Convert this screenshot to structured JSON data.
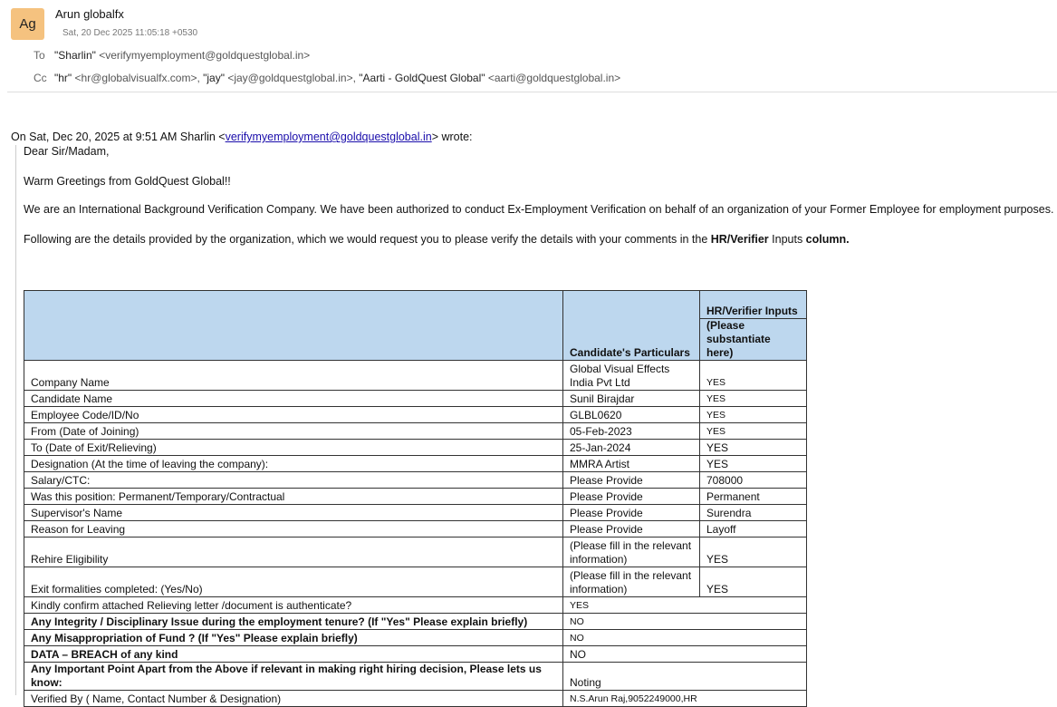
{
  "header": {
    "avatar": "Ag",
    "sender": "Arun globalfx",
    "date": "Sat, 20 Dec 2025 11:05:18 +0530",
    "to_label": "To",
    "to_name": "\"Sharlin\"",
    "to_addr": " <verifymyemployment@goldquestglobal.in>",
    "cc_label": "Cc",
    "cc": [
      {
        "name": "\"hr\"",
        "addr": " <hr@globalvisualfx.com>, "
      },
      {
        "name": "\"jay\"",
        "addr": " <jay@goldquestglobal.in>, "
      },
      {
        "name": "\"Aarti - GoldQuest Global\"",
        "addr": " <aarti@goldquestglobal.in>"
      }
    ]
  },
  "quote": {
    "intro_pre": "On Sat, Dec 20, 2025 at 9:51 AM Sharlin <",
    "intro_link": "verifymyemployment@goldquestglobal.in",
    "intro_post": "> wrote:",
    "p1": "Dear Sir/Madam,",
    "p2": "Warm Greetings from GoldQuest Global!!",
    "p3": "We are an International Background Verification Company. We have been authorized to conduct Ex-Employment Verification on behalf of an organization of your Former Employee for employment purposes.",
    "p4_a": "Following are the details provided by the organization, which we would request you to please verify the details with your comments in the ",
    "p4_b": "HR/Verifier",
    "p4_c": " Inputs ",
    "p4_d": "column."
  },
  "table": {
    "col2": "Candidate's Particulars",
    "col3a": "HR/Verifier Inputs",
    "col3b": "(Please substantiate here)",
    "rows": [
      [
        "Company Name",
        "Global Visual Effects India Pvt Ltd",
        "YES"
      ],
      [
        "Candidate Name",
        "Sunil Birajdar",
        "YES"
      ],
      [
        "Employee Code/ID/No",
        "GLBL0620",
        "YES"
      ],
      [
        "From (Date of Joining)",
        "05-Feb-2023",
        "YES"
      ],
      [
        "To (Date of Exit/Relieving)",
        "25-Jan-2024",
        "YES"
      ],
      [
        "Designation (At the time of leaving the company):",
        "MMRA Artist",
        "YES"
      ],
      [
        "Salary/CTC:",
        "Please Provide",
        "708000"
      ],
      [
        "Was this position: Permanent/Temporary/Contractual",
        "Please Provide",
        "Permanent"
      ],
      [
        "Supervisor's Name",
        "Please Provide",
        "Surendra"
      ],
      [
        "Reason for Leaving",
        "Please Provide",
        "Layoff"
      ],
      [
        "Rehire Eligibility",
        "(Please fill in the relevant information)",
        "YES"
      ],
      [
        "Exit formalities completed: (Yes/No)",
        "(Please fill in the relevant information)",
        "YES"
      ]
    ],
    "merged": [
      [
        "Kindly confirm attached Relieving letter /document is authenticate?",
        "YES",
        false
      ],
      [
        "Any Integrity / Disciplinary Issue during the employment tenure? (If \"Yes\" Please explain briefly)",
        "NO",
        true
      ],
      [
        "Any Misappropriation of Fund ? (If \"Yes\" Please explain briefly)",
        "NO",
        true
      ],
      [
        "DATA – BREACH of any kind",
        "NO",
        true
      ],
      [
        "Any Important Point Apart from the Above if relevant in making right hiring decision, Please lets us know:",
        "Noting",
        true
      ],
      [
        "Verified By ( Name, Contact Number & Designation)",
        "N.S.Arun Raj,9052249000,HR",
        false
      ]
    ]
  }
}
